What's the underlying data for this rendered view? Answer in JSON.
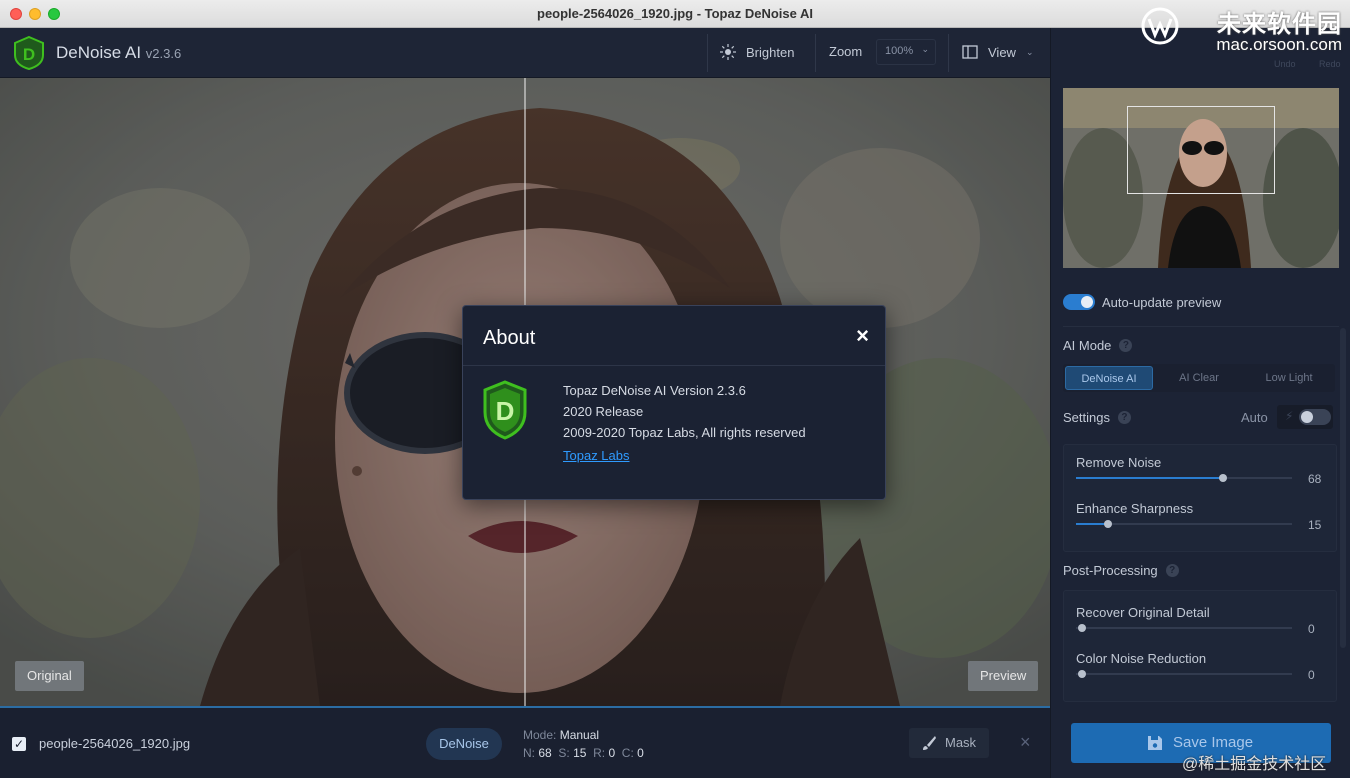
{
  "window": {
    "title": "people-2564026_1920.jpg - Topaz DeNoise AI"
  },
  "watermark": {
    "brand": "未来软件园",
    "url": "mac.orsoon.com",
    "corner": "@稀土掘金技术社区"
  },
  "header": {
    "app_name": "DeNoise AI",
    "version": "v2.3.6",
    "brighten_label": "Brighten",
    "zoom_label": "Zoom",
    "zoom_value": "100%",
    "view_label": "View"
  },
  "image_area": {
    "original_label": "Original",
    "preview_label": "Preview"
  },
  "about_dialog": {
    "title": "About",
    "close_glyph": "×",
    "version_line": "Topaz DeNoise AI Version 2.3.6",
    "release_line": "2020 Release",
    "copyright_line": "2009-2020 Topaz Labs, All rights reserved",
    "link_text": "Topaz Labs"
  },
  "bottom_bar": {
    "checked": true,
    "filename": "people-2564026_1920.jpg",
    "model_pill": "DeNoise",
    "mode_prefix": "Mode:",
    "mode_value": "Manual",
    "n_prefix": "N:",
    "n_value": "68",
    "s_prefix": "S:",
    "s_value": "15",
    "r_prefix": "R:",
    "r_value": "0",
    "c_prefix": "C:",
    "c_value": "0",
    "mask_label": "Mask",
    "close_glyph": "×"
  },
  "right_panel": {
    "undo_label": "Undo",
    "redo_label": "Redo",
    "auto_update_label": "Auto-update preview",
    "auto_update_on": true,
    "ai_mode_title": "AI Mode",
    "ai_modes": [
      "DeNoise AI",
      "AI Clear",
      "Low Light"
    ],
    "ai_mode_active": "DeNoise AI",
    "settings_title": "Settings",
    "settings_auto_label": "Auto",
    "settings_auto_on": false,
    "sliders": [
      {
        "label": "Remove Noise",
        "value": "68",
        "fraction": 0.68
      },
      {
        "label": "Enhance Sharpness",
        "value": "15",
        "fraction": 0.15
      }
    ],
    "post_title": "Post-Processing",
    "post_sliders": [
      {
        "label": "Recover Original Detail",
        "value": "0",
        "fraction": 0.0
      },
      {
        "label": "Color Noise Reduction",
        "value": "0",
        "fraction": 0.0
      }
    ],
    "save_label": "Save Image"
  },
  "colors": {
    "accent": "#2a7dd0",
    "link": "#2f9bff",
    "logo_green": "#3fbf1f",
    "panel_bg": "#1c2335"
  },
  "icons": {
    "logo": "denoise-d-shield-icon",
    "brighten": "sun-icon",
    "view": "split-view-icon",
    "mask": "brush-icon",
    "save": "floppy-disk-icon",
    "help": "question-circle-icon",
    "auto": "lightning-icon"
  }
}
